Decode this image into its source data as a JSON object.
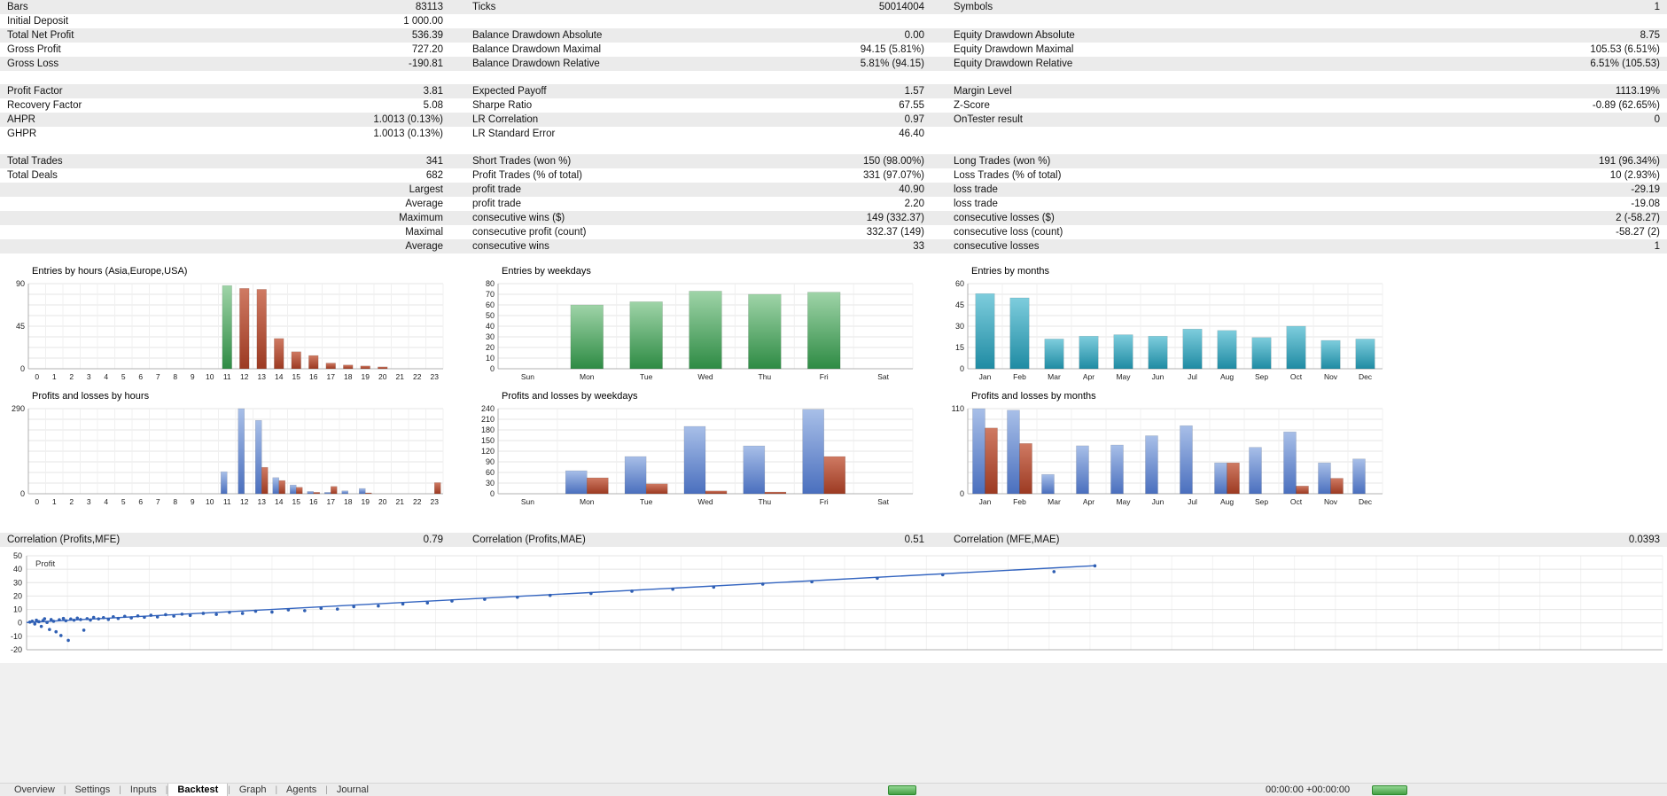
{
  "colors": {
    "profit_blue": "#4a6fbe",
    "loss_red": "#9c3a22",
    "entry_green": "#2e8b44",
    "entry_teal": "#1f8ba3",
    "row_shade": "#ebebeb",
    "grid_line": "#e4e4e4",
    "scatter_line": "#3465c0"
  },
  "stats": {
    "rows": [
      {
        "shade": true,
        "cells": [
          [
            "Bars",
            "83113"
          ],
          [
            "Ticks",
            "50014004"
          ],
          [
            "Symbols",
            "1"
          ]
        ]
      },
      {
        "shade": false,
        "cells": [
          [
            "Initial Deposit",
            "1 000.00"
          ],
          [
            "",
            ""
          ],
          [
            "",
            ""
          ]
        ]
      },
      {
        "shade": true,
        "cells": [
          [
            "Total Net Profit",
            "536.39"
          ],
          [
            "Balance Drawdown Absolute",
            "0.00"
          ],
          [
            "Equity Drawdown Absolute",
            "8.75"
          ]
        ]
      },
      {
        "shade": false,
        "cells": [
          [
            "Gross Profit",
            "727.20"
          ],
          [
            "Balance Drawdown Maximal",
            "94.15 (5.81%)"
          ],
          [
            "Equity Drawdown Maximal",
            "105.53 (6.51%)"
          ]
        ]
      },
      {
        "shade": true,
        "cells": [
          [
            "Gross Loss",
            "-190.81"
          ],
          [
            "Balance Drawdown Relative",
            "5.81% (94.15)"
          ],
          [
            "Equity Drawdown Relative",
            "6.51% (105.53)"
          ]
        ]
      },
      {
        "gap": true
      },
      {
        "shade": true,
        "cells": [
          [
            "Profit Factor",
            "3.81"
          ],
          [
            "Expected Payoff",
            "1.57"
          ],
          [
            "Margin Level",
            "1113.19%"
          ]
        ]
      },
      {
        "shade": false,
        "cells": [
          [
            "Recovery Factor",
            "5.08"
          ],
          [
            "Sharpe Ratio",
            "67.55"
          ],
          [
            "Z-Score",
            "-0.89 (62.65%)"
          ]
        ]
      },
      {
        "shade": true,
        "cells": [
          [
            "AHPR",
            "1.0013 (0.13%)"
          ],
          [
            "LR Correlation",
            "0.97"
          ],
          [
            "OnTester result",
            "0"
          ]
        ]
      },
      {
        "shade": false,
        "cells": [
          [
            "GHPR",
            "1.0013 (0.13%)"
          ],
          [
            "LR Standard Error",
            "46.40"
          ],
          [
            "",
            ""
          ]
        ]
      },
      {
        "gap": true
      },
      {
        "shade": true,
        "cells": [
          [
            "Total Trades",
            "341"
          ],
          [
            "Short Trades (won %)",
            "150 (98.00%)"
          ],
          [
            "Long Trades (won %)",
            "191 (96.34%)"
          ]
        ]
      },
      {
        "shade": false,
        "cells": [
          [
            "Total Deals",
            "682"
          ],
          [
            "Profit Trades (% of total)",
            "331 (97.07%)"
          ],
          [
            "Loss Trades (% of total)",
            "10 (2.93%)"
          ]
        ]
      },
      {
        "shade": true,
        "cells": [
          [
            "",
            "Largest"
          ],
          [
            "profit trade",
            "40.90"
          ],
          [
            "loss trade",
            "-29.19"
          ]
        ]
      },
      {
        "shade": false,
        "cells": [
          [
            "",
            "Average"
          ],
          [
            "profit trade",
            "2.20"
          ],
          [
            "loss trade",
            "-19.08"
          ]
        ]
      },
      {
        "shade": true,
        "cells": [
          [
            "",
            "Maximum"
          ],
          [
            "consecutive wins ($)",
            "149 (332.37)"
          ],
          [
            "consecutive losses ($)",
            "2 (-58.27)"
          ]
        ]
      },
      {
        "shade": false,
        "cells": [
          [
            "",
            "Maximal"
          ],
          [
            "consecutive profit (count)",
            "332.37 (149)"
          ],
          [
            "consecutive loss (count)",
            "-58.27 (2)"
          ]
        ]
      },
      {
        "shade": true,
        "cells": [
          [
            "",
            "Average"
          ],
          [
            "consecutive wins",
            "33"
          ],
          [
            "consecutive losses",
            "1"
          ]
        ]
      }
    ]
  },
  "correlations": {
    "shade": true,
    "cells": [
      [
        "Correlation (Profits,MFE)",
        "0.79"
      ],
      [
        "Correlation (Profits,MAE)",
        "0.51"
      ],
      [
        "Correlation (MFE,MAE)",
        "0.0393"
      ]
    ]
  },
  "chart_data": [
    {
      "id": "entries-by-hours",
      "type": "bar",
      "title": "Entries by hours (Asia,Europe,USA)",
      "categories": [
        "0",
        "1",
        "2",
        "3",
        "4",
        "5",
        "6",
        "7",
        "8",
        "9",
        "10",
        "11",
        "12",
        "13",
        "14",
        "15",
        "16",
        "17",
        "18",
        "19",
        "20",
        "21",
        "22",
        "23"
      ],
      "values": [
        0,
        0,
        0,
        0,
        0,
        0,
        0,
        0,
        0,
        0,
        0,
        88,
        85,
        84,
        32,
        18,
        14,
        6,
        4,
        3,
        2,
        0,
        0,
        0
      ],
      "bar_colors": [
        "red",
        "red",
        "red",
        "red",
        "red",
        "red",
        "red",
        "red",
        "red",
        "red",
        "red",
        "green",
        "red",
        "red",
        "red",
        "red",
        "red",
        "red",
        "red",
        "red",
        "red",
        "red",
        "red",
        "red"
      ],
      "ymax": 90,
      "yticks": [
        0,
        45,
        90
      ]
    },
    {
      "id": "entries-by-weekdays",
      "type": "bar",
      "title": "Entries by weekdays",
      "categories": [
        "Sun",
        "Mon",
        "Tue",
        "Wed",
        "Thu",
        "Fri",
        "Sat"
      ],
      "values": [
        0,
        60,
        63,
        73,
        70,
        72,
        0
      ],
      "color": "green",
      "ymax": 80,
      "yticks": [
        0,
        10,
        20,
        30,
        40,
        50,
        60,
        70,
        80
      ]
    },
    {
      "id": "entries-by-months",
      "type": "bar",
      "title": "Entries by months",
      "categories": [
        "Jan",
        "Feb",
        "Mar",
        "Apr",
        "May",
        "Jun",
        "Jul",
        "Aug",
        "Sep",
        "Oct",
        "Nov",
        "Dec"
      ],
      "values": [
        53,
        50,
        21,
        23,
        24,
        23,
        28,
        27,
        22,
        30,
        20,
        21
      ],
      "color": "teal",
      "ymax": 60,
      "yticks": [
        0,
        15,
        30,
        45,
        60
      ]
    },
    {
      "id": "pl-by-hours",
      "type": "bar",
      "title": "Profits and losses by hours",
      "categories": [
        "0",
        "1",
        "2",
        "3",
        "4",
        "5",
        "6",
        "7",
        "8",
        "9",
        "10",
        "11",
        "12",
        "13",
        "14",
        "15",
        "16",
        "17",
        "18",
        "19",
        "20",
        "21",
        "22",
        "23"
      ],
      "series": [
        {
          "name": "profit",
          "color": "blue",
          "values": [
            0,
            0,
            0,
            0,
            0,
            0,
            0,
            0,
            0,
            0,
            0,
            75,
            290,
            250,
            55,
            30,
            8,
            5,
            10,
            18,
            0,
            0,
            0,
            0
          ]
        },
        {
          "name": "loss",
          "color": "red",
          "values": [
            0,
            0,
            0,
            0,
            0,
            0,
            0,
            0,
            0,
            0,
            0,
            0,
            0,
            90,
            45,
            22,
            5,
            25,
            0,
            3,
            0,
            0,
            0,
            38
          ]
        }
      ],
      "ymax": 290,
      "yticks": [
        0,
        290
      ]
    },
    {
      "id": "pl-by-weekdays",
      "type": "bar",
      "title": "Profits and losses by weekdays",
      "categories": [
        "Sun",
        "Mon",
        "Tue",
        "Wed",
        "Thu",
        "Fri",
        "Sat"
      ],
      "series": [
        {
          "name": "profit",
          "color": "blue",
          "values": [
            0,
            65,
            105,
            190,
            135,
            238,
            0
          ]
        },
        {
          "name": "loss",
          "color": "red",
          "values": [
            0,
            45,
            28,
            8,
            5,
            105,
            0
          ]
        }
      ],
      "ymax": 240,
      "yticks": [
        0,
        30,
        60,
        90,
        120,
        150,
        180,
        210,
        240
      ]
    },
    {
      "id": "pl-by-months",
      "type": "bar",
      "title": "Profits and losses by months",
      "categories": [
        "Jan",
        "Feb",
        "Mar",
        "Apr",
        "May",
        "Jun",
        "Jul",
        "Aug",
        "Sep",
        "Oct",
        "Nov",
        "Dec"
      ],
      "series": [
        {
          "name": "profit",
          "color": "blue",
          "values": [
            110,
            108,
            25,
            62,
            63,
            75,
            88,
            40,
            60,
            80,
            40,
            45
          ]
        },
        {
          "name": "loss",
          "color": "red",
          "values": [
            85,
            65,
            0,
            0,
            0,
            0,
            0,
            40,
            0,
            10,
            20,
            0
          ]
        }
      ],
      "ymax": 110,
      "yticks": [
        0,
        110
      ]
    },
    {
      "id": "profit-mfe-scatter",
      "type": "scatter",
      "label": "Profit",
      "ylim": [
        -20,
        50
      ],
      "yticks": [
        50,
        40,
        30,
        20,
        10,
        0,
        -10,
        -20
      ],
      "points": [
        [
          0.2,
          0.6
        ],
        [
          0.35,
          1.3
        ],
        [
          0.5,
          -0.8
        ],
        [
          0.6,
          2.0
        ],
        [
          0.75,
          0.9
        ],
        [
          0.9,
          -2.6
        ],
        [
          1.0,
          1.7
        ],
        [
          1.1,
          3.1
        ],
        [
          1.25,
          0.3
        ],
        [
          1.4,
          -4.9
        ],
        [
          1.5,
          2.5
        ],
        [
          1.65,
          1.2
        ],
        [
          1.8,
          -6.6
        ],
        [
          2.0,
          2.3
        ],
        [
          2.1,
          -9.4
        ],
        [
          2.25,
          3.3
        ],
        [
          2.4,
          1.6
        ],
        [
          2.55,
          -13.0
        ],
        [
          2.7,
          2.9
        ],
        [
          2.9,
          2.0
        ],
        [
          3.1,
          3.6
        ],
        [
          3.3,
          2.5
        ],
        [
          3.5,
          -5.4
        ],
        [
          3.7,
          3.2
        ],
        [
          3.9,
          2.1
        ],
        [
          4.1,
          4.1
        ],
        [
          4.4,
          3.0
        ],
        [
          4.7,
          3.9
        ],
        [
          5.0,
          2.6
        ],
        [
          5.3,
          4.6
        ],
        [
          5.6,
          3.3
        ],
        [
          6.0,
          4.9
        ],
        [
          6.4,
          3.7
        ],
        [
          6.8,
          5.2
        ],
        [
          7.2,
          4.2
        ],
        [
          7.6,
          5.7
        ],
        [
          8.0,
          4.5
        ],
        [
          8.5,
          6.1
        ],
        [
          9.0,
          5.1
        ],
        [
          9.5,
          6.5
        ],
        [
          10.0,
          5.6
        ],
        [
          10.8,
          7.1
        ],
        [
          11.6,
          6.3
        ],
        [
          12.4,
          7.9
        ],
        [
          13.2,
          7.1
        ],
        [
          14.0,
          8.7
        ],
        [
          15.0,
          8.1
        ],
        [
          16.0,
          9.7
        ],
        [
          17.0,
          9.1
        ],
        [
          18.0,
          10.9
        ],
        [
          19.0,
          10.3
        ],
        [
          20.0,
          12.1
        ],
        [
          21.5,
          12.6
        ],
        [
          23.0,
          14.1
        ],
        [
          24.5,
          14.9
        ],
        [
          26.0,
          16.3
        ],
        [
          28.0,
          17.6
        ],
        [
          30.0,
          19.1
        ],
        [
          32.0,
          20.5
        ],
        [
          34.5,
          21.9
        ],
        [
          37.0,
          23.6
        ],
        [
          39.5,
          25.1
        ],
        [
          42.0,
          26.6
        ],
        [
          45.0,
          28.9
        ],
        [
          48.0,
          30.6
        ],
        [
          52.0,
          33.3
        ],
        [
          56.0,
          35.9
        ],
        [
          62.8,
          38.2
        ],
        [
          65.3,
          42.5
        ]
      ],
      "trend": [
        [
          0,
          0.3
        ],
        [
          65.3,
          42.6
        ]
      ]
    }
  ],
  "tabs": [
    {
      "label": "Overview",
      "active": false
    },
    {
      "label": "Settings",
      "active": false
    },
    {
      "label": "Inputs",
      "active": false
    },
    {
      "label": "Backtest",
      "active": true
    },
    {
      "label": "Graph",
      "active": false
    },
    {
      "label": "Agents",
      "active": false
    },
    {
      "label": "Journal",
      "active": false
    }
  ],
  "statusbar": {
    "time": "00:00:00 +00:00:00"
  }
}
